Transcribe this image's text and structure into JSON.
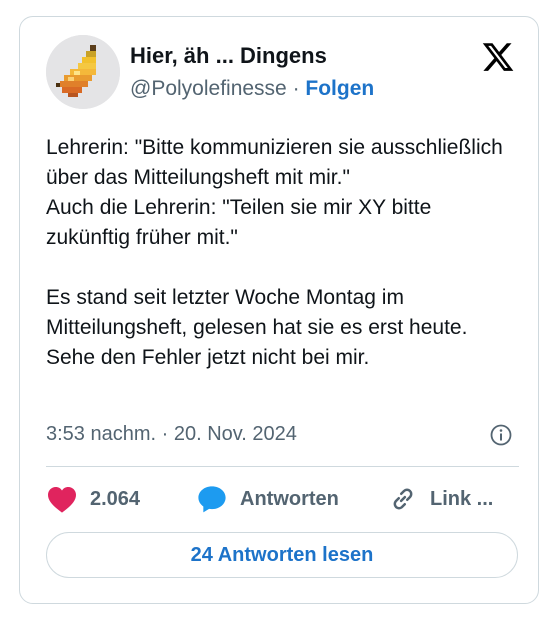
{
  "author": {
    "display_name": "Hier, äh ... Dingens",
    "handle": "@Polyolefinesse",
    "separator": " · ",
    "follow_label": "Folgen",
    "avatar_icon": "banana-pixel-avatar"
  },
  "platform_icon": "x-logo-icon",
  "tweet": {
    "text": "Lehrerin: \"Bitte kommunizieren sie ausschließlich über das Mitteilungsheft mit mir.\"\nAuch die Lehrerin: \"Teilen sie mir XY bitte zukünftig früher mit.\"\n\nEs stand seit letzter Woche Montag im Mitteilungsheft, gelesen hat sie es erst heute. Sehe den Fehler jetzt nicht bei mir.",
    "timestamp": "3:53 nachm. · 20. Nov. 2024"
  },
  "actions": {
    "likes": "2.064",
    "reply_label": "Antworten",
    "link_label": "Link ...",
    "read_replies_label": "24 Antworten lesen"
  },
  "colors": {
    "like": "#e0245e",
    "reply": "#1d9bf0",
    "link_text": "#1d73c9",
    "muted": "#536471"
  }
}
